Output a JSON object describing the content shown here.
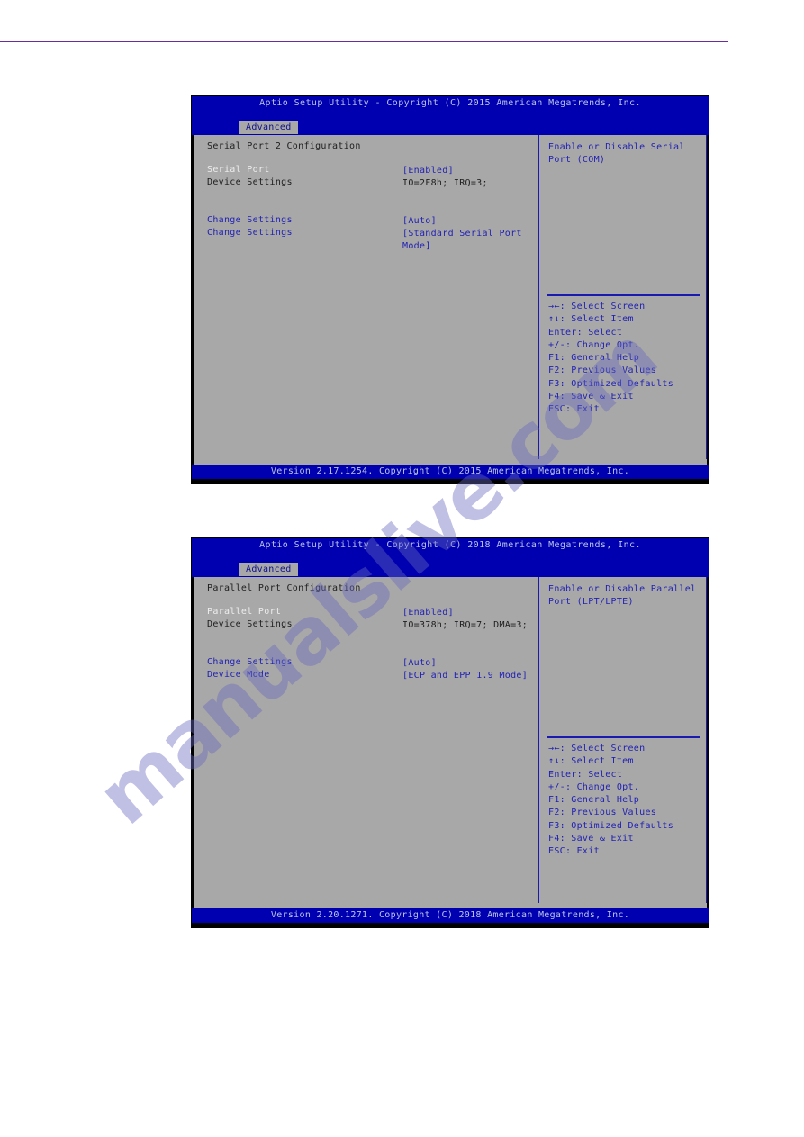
{
  "page": {
    "watermark": "manualslive.com",
    "rule_color": "#6a2d9b"
  },
  "colors": {
    "title_bar": "#0000b0",
    "body_bg": "#a8a8a8",
    "border": "#1a1ab0",
    "value_blue": "#2222b4",
    "selected_text": "#ededed",
    "label_dark": "#1e1e1e"
  },
  "screens": [
    {
      "title": "Aptio Setup Utility - Copyright (C) 2015 American Megatrends, Inc.",
      "tab": "Advanced",
      "section_heading": "Serial Port 2 Configuration",
      "rows": [
        {
          "label": "Serial Port",
          "value": "[Enabled]",
          "label_style": "c-sel",
          "value_style": "c-blue"
        },
        {
          "label": "Device Settings",
          "value": "IO=2F8h; IRQ=3;",
          "label_style": "c-dark",
          "value_style": "c-dark"
        },
        {
          "label": "",
          "value": "",
          "label_style": "c-dark",
          "value_style": "c-dark"
        },
        {
          "label": "Change Settings",
          "value": "[Auto]",
          "label_style": "c-blue",
          "value_style": "c-blue"
        },
        {
          "label": "Change Settings",
          "value": "[Standard Serial Port Mode]",
          "label_style": "c-blue",
          "value_style": "c-blue"
        }
      ],
      "help": "Enable or Disable Serial Port (COM)",
      "keys": [
        "→←: Select Screen",
        "↑↓: Select Item",
        "Enter: Select",
        "+/-: Change Opt.",
        "F1: General Help",
        "F2: Previous Values",
        "F3: Optimized Defaults",
        "F4: Save & Exit",
        "ESC: Exit"
      ],
      "footer": "Version 2.17.1254. Copyright (C) 2015 American Megatrends, Inc."
    },
    {
      "title": "Aptio Setup Utility - Copyright (C) 2018 American Megatrends, Inc.",
      "tab": "Advanced",
      "section_heading": "Parallel Port Configuration",
      "rows": [
        {
          "label": "Parallel Port",
          "value": "[Enabled]",
          "label_style": "c-sel",
          "value_style": "c-blue"
        },
        {
          "label": "Device Settings",
          "value": "IO=378h; IRQ=7; DMA=3;",
          "label_style": "c-dark",
          "value_style": "c-dark"
        },
        {
          "label": "",
          "value": "",
          "label_style": "c-dark",
          "value_style": "c-dark"
        },
        {
          "label": "Change Settings",
          "value": "[Auto]",
          "label_style": "c-blue",
          "value_style": "c-blue"
        },
        {
          "label": "Device Mode",
          "value": "[ECP and EPP 1.9 Mode]",
          "label_style": "c-blue",
          "value_style": "c-blue"
        }
      ],
      "help": "Enable or Disable Parallel Port (LPT/LPTE)",
      "keys": [
        "→←: Select Screen",
        "↑↓: Select Item",
        "Enter: Select",
        "+/-: Change Opt.",
        "F1: General Help",
        "F2: Previous Values",
        "F3: Optimized Defaults",
        "F4: Save & Exit",
        "ESC: Exit"
      ],
      "footer": "Version 2.20.1271. Copyright (C) 2018 American Megatrends, Inc."
    }
  ]
}
